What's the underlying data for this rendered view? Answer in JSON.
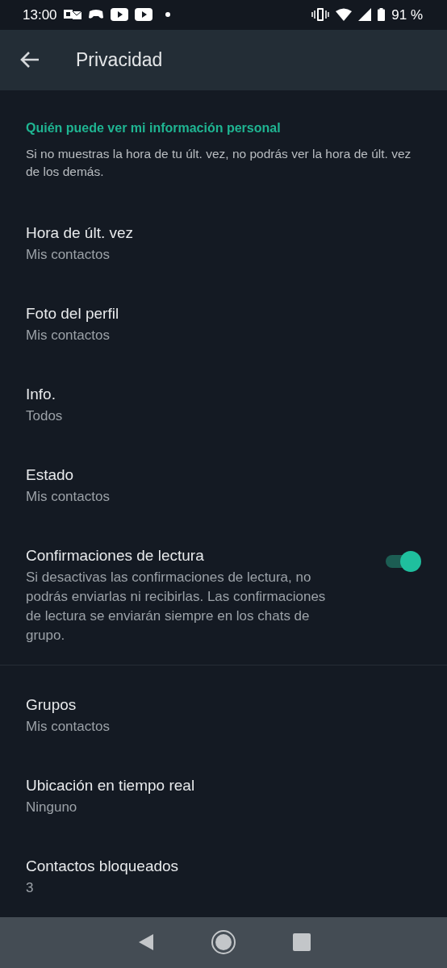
{
  "status_bar": {
    "time": "13:00",
    "battery": "91 %"
  },
  "app_bar": {
    "title": "Privacidad"
  },
  "sections": [
    {
      "title": "Quién puede ver mi información personal",
      "description": "Si no muestras la hora de tu últ. vez, no podrás ver la hora de últ. vez de los demás.",
      "items": [
        {
          "kind": "choice",
          "title": "Hora de últ. vez",
          "value": "Mis contactos"
        },
        {
          "kind": "choice",
          "title": "Foto del perfil",
          "value": "Mis contactos"
        },
        {
          "kind": "choice",
          "title": "Info.",
          "value": "Todos"
        },
        {
          "kind": "choice",
          "title": "Estado",
          "value": "Mis contactos"
        },
        {
          "kind": "toggle",
          "title": "Confirmaciones de lectura",
          "description": "Si desactivas las confirmaciones de lectura, no podrás enviarlas ni recibirlas. Las confirmaciones de lectura se enviarán siempre en los chats de grupo.",
          "on": true
        }
      ]
    },
    {
      "items": [
        {
          "kind": "choice",
          "title": "Grupos",
          "value": "Mis contactos"
        },
        {
          "kind": "choice",
          "title": "Ubicación en tiempo real",
          "value": "Ninguno"
        },
        {
          "kind": "choice",
          "title": "Contactos bloqueados",
          "value": "3"
        }
      ]
    }
  ]
}
